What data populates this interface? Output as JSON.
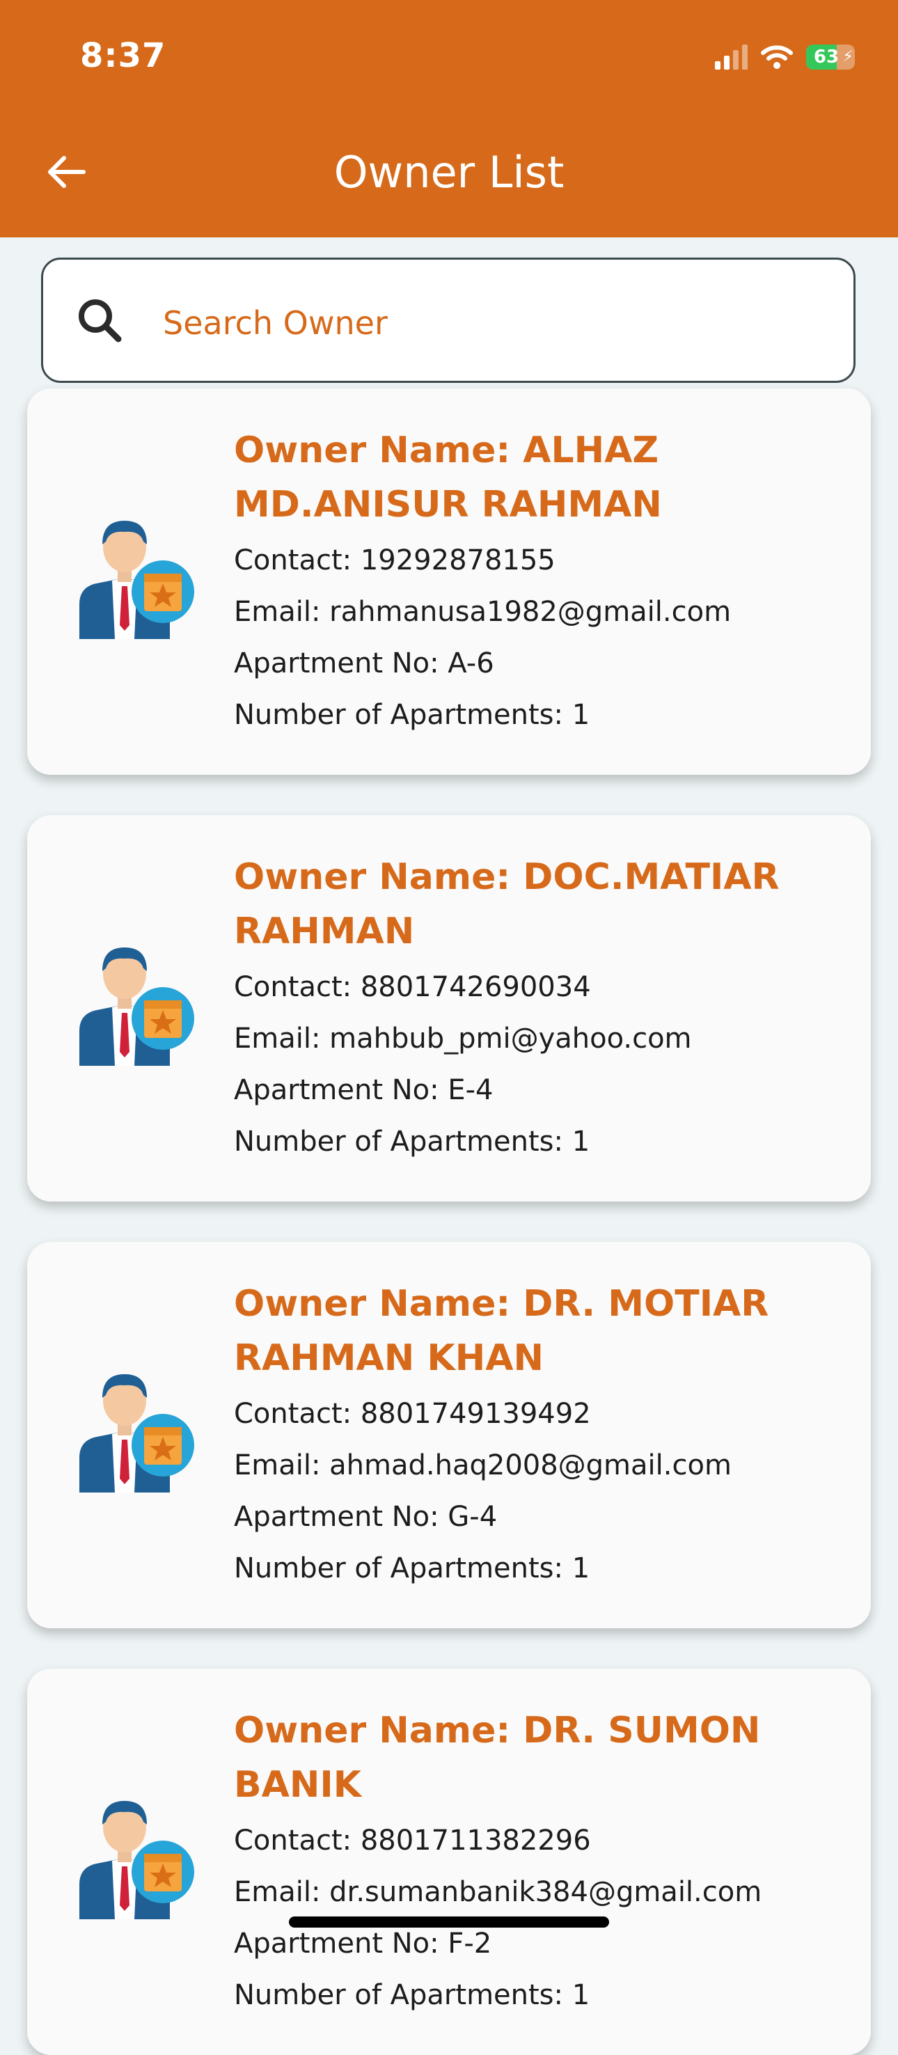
{
  "status_bar": {
    "time": "8:37",
    "battery": "63",
    "battery_level": 0.63
  },
  "header": {
    "title": "Owner List"
  },
  "search": {
    "placeholder": "Search Owner"
  },
  "owners": [
    {
      "name": "Owner Name: ALHAZ MD.ANISUR RAHMAN",
      "contact": "Contact: 19292878155",
      "email": "Email: rahmanusa1982@gmail.com",
      "apartment": "Apartment No: A-6",
      "count": "Number of Apartments: 1"
    },
    {
      "name": "Owner Name: DOC.MATIAR RAHMAN",
      "contact": "Contact: 8801742690034",
      "email": "Email: mahbub_pmi@yahoo.com",
      "apartment": "Apartment No: E-4",
      "count": "Number of Apartments: 1"
    },
    {
      "name": "Owner Name: DR. MOTIAR RAHMAN KHAN",
      "contact": "Contact: 8801749139492",
      "email": "Email: ahmad.haq2008@gmail.com",
      "apartment": "Apartment No: G-4",
      "count": "Number of Apartments: 1"
    },
    {
      "name": "Owner Name: DR. SUMON BANIK",
      "contact": "Contact: 8801711382296",
      "email": "Email: dr.sumanbanik384@gmail.com",
      "apartment": "Apartment No: F-2",
      "count": "Number of Apartments: 1"
    }
  ],
  "icons": {
    "back": "arrow-left-icon",
    "search": "magnifier-icon",
    "owner": "businessman-badge-icon"
  },
  "colors": {
    "accent": "#d66a1a",
    "background": "#eef4f5",
    "card": "#fafafa"
  }
}
